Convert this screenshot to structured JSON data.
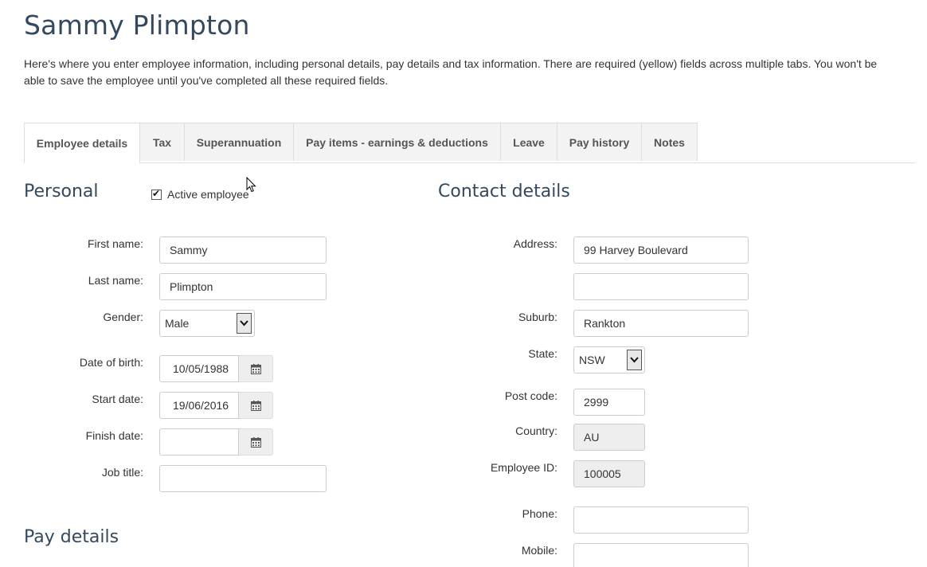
{
  "page": {
    "title": "Sammy Plimpton",
    "intro": "Here's where you enter employee information, including personal details, pay details and tax information. There are required (yellow) fields across multiple tabs. You won't be able to save the employee until you've completed all these required fields."
  },
  "tabs": [
    {
      "label": "Employee details",
      "active": true
    },
    {
      "label": "Tax"
    },
    {
      "label": "Superannuation"
    },
    {
      "label": "Pay items - earnings & deductions"
    },
    {
      "label": "Leave"
    },
    {
      "label": "Pay history"
    },
    {
      "label": "Notes"
    }
  ],
  "personal": {
    "heading": "Personal",
    "active_label": "Active employee",
    "active_checked": true,
    "first_name_label": "First name:",
    "first_name": "Sammy",
    "last_name_label": "Last name:",
    "last_name": "Plimpton",
    "gender_label": "Gender:",
    "gender": "Male",
    "dob_label": "Date of birth:",
    "dob": "10/05/1988",
    "start_label": "Start date:",
    "start": "19/06/2016",
    "finish_label": "Finish date:",
    "finish": "",
    "job_label": "Job title:",
    "job": ""
  },
  "contact": {
    "heading": "Contact details",
    "address_label": "Address:",
    "address1": "99 Harvey Boulevard",
    "address2": "",
    "suburb_label": "Suburb:",
    "suburb": "Rankton",
    "state_label": "State:",
    "state": "NSW",
    "postcode_label": "Post code:",
    "postcode": "2999",
    "country_label": "Country:",
    "country": "AU",
    "empid_label": "Employee ID:",
    "empid": "100005",
    "phone_label": "Phone:",
    "phone": "",
    "mobile_label": "Mobile:",
    "mobile": ""
  },
  "pay_details": {
    "heading": "Pay details"
  }
}
